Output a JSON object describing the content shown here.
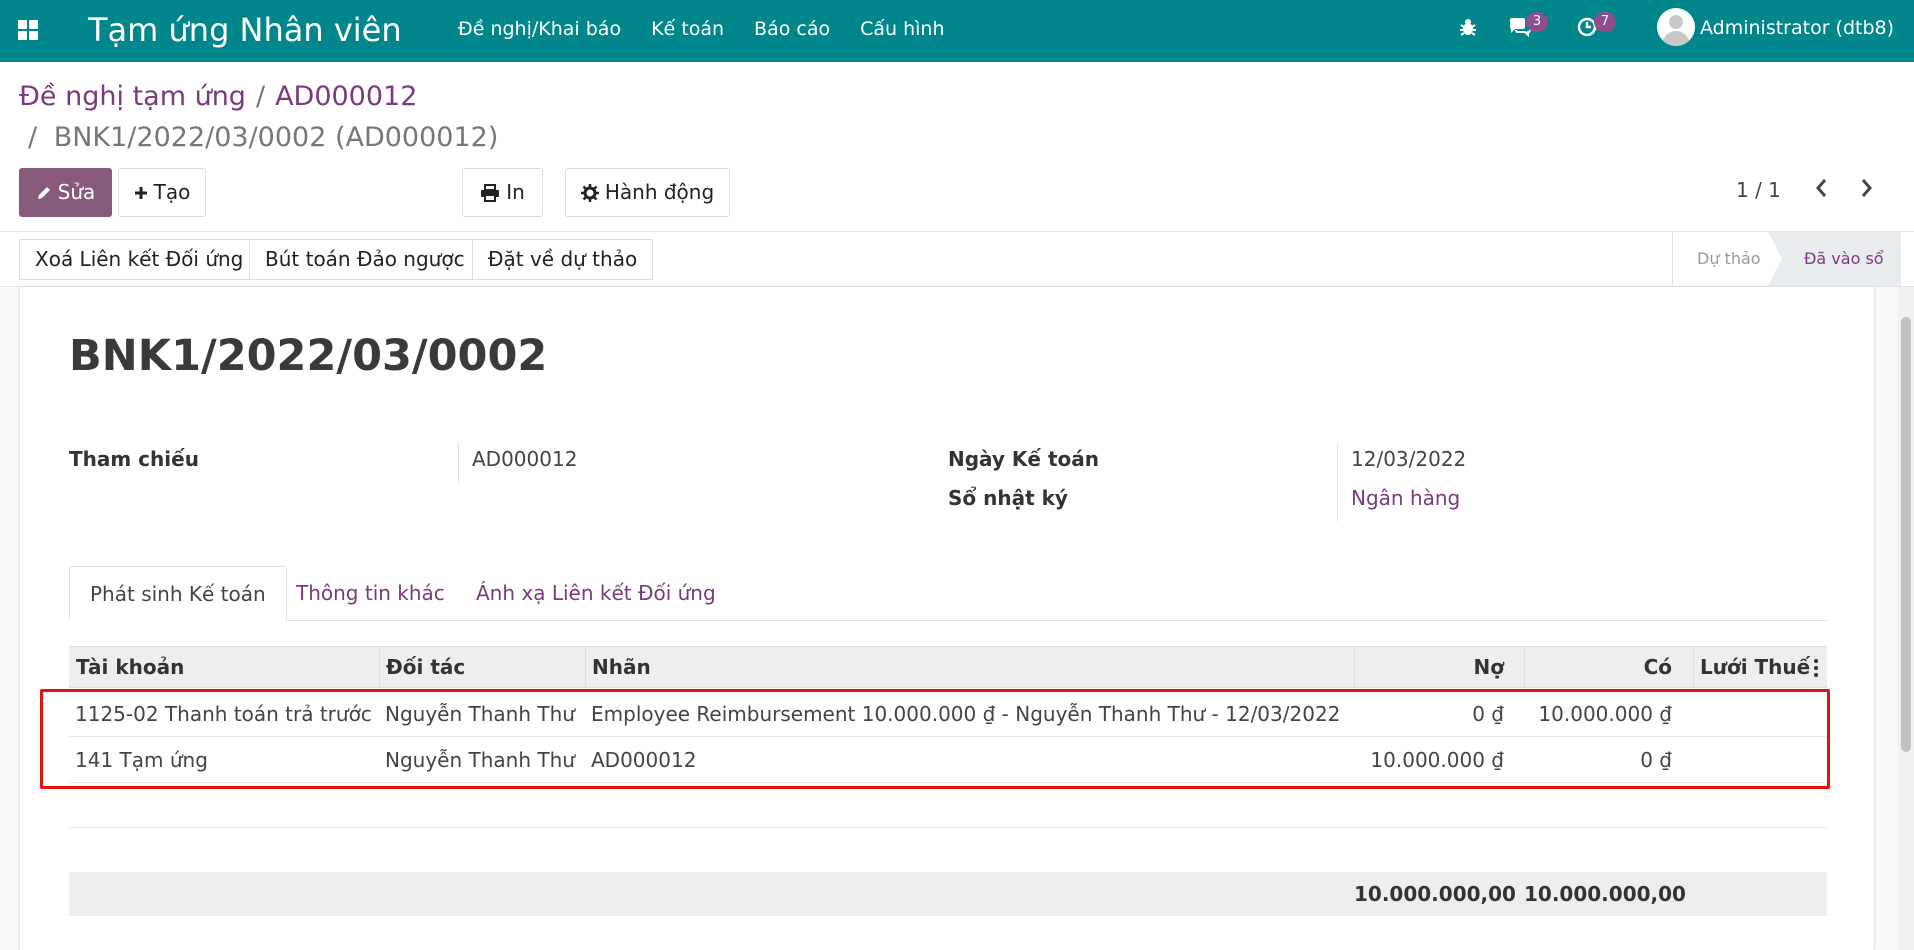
{
  "navbar": {
    "app_title": "Tạm ứng Nhân viên",
    "menu": [
      "Đề nghị/Khai báo",
      "Kế toán",
      "Báo cáo",
      "Cấu hình"
    ],
    "messages_count": "3",
    "activities_count": "7",
    "user": "Administrator (dtb8)"
  },
  "breadcrumb": {
    "root": "Đề nghị tạm ứng",
    "sep1": "/",
    "parent": "AD000012",
    "sep2": "/",
    "current": "BNK1/2022/03/0002 (AD000012)"
  },
  "toolbar": {
    "edit": "Sửa",
    "create": "Tạo",
    "print": "In",
    "action": "Hành động",
    "pager": "1 / 1"
  },
  "statusbar": {
    "buttons": [
      "Xoá Liên kết Đối ứng",
      "Bút toán Đảo ngược",
      "Đặt về dự thảo"
    ],
    "stages": [
      "Dự thảo",
      "Đã vào sổ"
    ],
    "active_stage": "Đã vào sổ"
  },
  "form": {
    "name": "BNK1/2022/03/0002",
    "ref_label": "Tham chiếu",
    "ref_value": "AD000012",
    "date_label": "Ngày Kế toán",
    "date_value": "12/03/2022",
    "journal_label": "Sổ nhật ký",
    "journal_value": "Ngân hàng"
  },
  "tabs": [
    "Phát sinh Kế toán",
    "Thông tin khác",
    "Ánh xạ Liên kết Đối ứng"
  ],
  "table": {
    "headers": [
      "Tài khoản",
      "Đối tác",
      "Nhãn",
      "Nợ",
      "Có",
      "Lưới Thuế"
    ],
    "rows": [
      [
        "1125-02 Thanh toán trả trước",
        "Nguyễn Thanh Thư",
        "Employee Reimbursement 10.000.000 ₫ - Nguyễn Thanh Thư - 12/03/2022",
        "0 ₫",
        "10.000.000 ₫",
        ""
      ],
      [
        "141 Tạm ứng",
        "Nguyễn Thanh Thư",
        "AD000012",
        "10.000.000 ₫",
        "0 ₫",
        ""
      ]
    ],
    "totals": [
      "10.000.000,00",
      "10.000.000,00"
    ]
  },
  "colors": {
    "navbar": "#00868b",
    "primary": "#875a7b",
    "link": "#7c3a7e",
    "highlight": "#e3120b"
  }
}
